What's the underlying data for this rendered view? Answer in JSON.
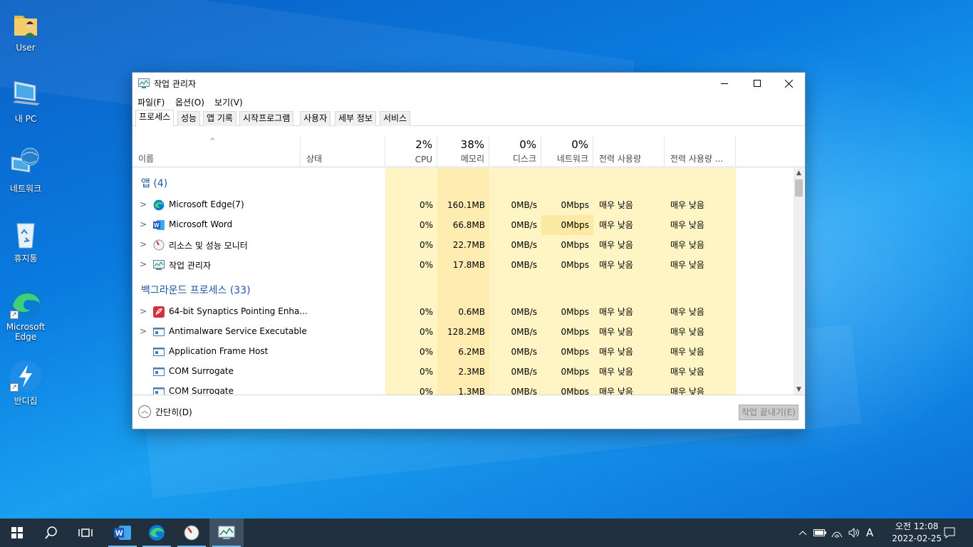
{
  "desktop": {
    "icons": [
      {
        "label": "User"
      },
      {
        "label": "내 PC"
      },
      {
        "label": "네트워크"
      },
      {
        "label": "휴지통"
      },
      {
        "label": "Microsoft Edge"
      },
      {
        "label": "반디집"
      }
    ]
  },
  "window": {
    "title": "작업 관리자",
    "menu": [
      "파일(F)",
      "옵션(O)",
      "보기(V)"
    ],
    "tabs": [
      "프로세스",
      "성능",
      "앱 기록",
      "시작프로그램",
      "사용자",
      "세부 정보",
      "서비스"
    ],
    "active_tab": "프로세스",
    "columns": {
      "name": "이름",
      "status": "상태",
      "cpu": {
        "pct": "2%",
        "label": "CPU"
      },
      "memory": {
        "pct": "38%",
        "label": "메모리"
      },
      "disk": {
        "pct": "0%",
        "label": "디스크"
      },
      "network": {
        "pct": "0%",
        "label": "네트워크"
      },
      "power": "전력 사용량",
      "power_trend": "전력 사용량 ..."
    },
    "groups": [
      {
        "label": "앱 (4)"
      },
      {
        "label": "백그라운드 프로세스 (33)"
      }
    ],
    "apps": [
      {
        "icon": "edge-icon",
        "name": "Microsoft Edge(7)",
        "cpu": "0%",
        "mem": "160.1MB",
        "disk": "0MB/s",
        "net": "0Mbps",
        "power": "매우 낮음",
        "trend": "매우 낮음",
        "expandable": ">"
      },
      {
        "icon": "word-icon",
        "name": "Microsoft Word",
        "cpu": "0%",
        "mem": "66.8MB",
        "disk": "0MB/s",
        "net": "0Mbps",
        "power": "매우 낮음",
        "trend": "매우 낮음",
        "expandable": ">"
      },
      {
        "icon": "resource-monitor-icon",
        "name": "리소스 및 성능 모니터",
        "cpu": "0%",
        "mem": "22.7MB",
        "disk": "0MB/s",
        "net": "0Mbps",
        "power": "매우 낮음",
        "trend": "매우 낮음",
        "expandable": ">"
      },
      {
        "icon": "task-manager-icon",
        "name": "작업 관리자",
        "cpu": "0%",
        "mem": "17.8MB",
        "disk": "0MB/s",
        "net": "0Mbps",
        "power": "매우 낮음",
        "trend": "매우 낮음",
        "expandable": ">"
      }
    ],
    "background": [
      {
        "icon": "synaptics-icon",
        "name": "64-bit Synaptics Pointing Enha...",
        "cpu": "0%",
        "mem": "0.6MB",
        "disk": "0MB/s",
        "net": "0Mbps",
        "power": "매우 낮음",
        "trend": "매우 낮음",
        "expandable": ">"
      },
      {
        "icon": "service-icon",
        "name": "Antimalware Service Executable",
        "cpu": "0%",
        "mem": "128.2MB",
        "disk": "0MB/s",
        "net": "0Mbps",
        "power": "매우 낮음",
        "trend": "매우 낮음",
        "expandable": ">"
      },
      {
        "icon": "service-icon",
        "name": "Application Frame Host",
        "cpu": "0%",
        "mem": "6.2MB",
        "disk": "0MB/s",
        "net": "0Mbps",
        "power": "매우 낮음",
        "trend": "매우 낮음",
        "expandable": ""
      },
      {
        "icon": "service-icon",
        "name": "COM Surrogate",
        "cpu": "0%",
        "mem": "2.3MB",
        "disk": "0MB/s",
        "net": "0Mbps",
        "power": "매우 낮음",
        "trend": "매우 낮음",
        "expandable": ""
      },
      {
        "icon": "service-icon",
        "name": "COM Surrogate",
        "cpu": "0%",
        "mem": "1.3MB",
        "disk": "0MB/s",
        "net": "0Mbps",
        "power": "매우 낮음",
        "trend": "매우 낮음",
        "expandable": ""
      }
    ],
    "footer": {
      "collapse_label": "간단히(D)",
      "end_task_label": "작업 끝내기(E)"
    }
  },
  "taskbar": {
    "pinned": [
      "start-icon",
      "search-icon",
      "task-view-icon",
      "word-icon",
      "edge-icon",
      "resource-monitor-icon",
      "task-manager-icon"
    ],
    "ime": "A",
    "time": "오전 12:08",
    "date": "2022-02-25"
  },
  "colors": {
    "accent": "#1e57a6",
    "heat_light": "#fff4c4",
    "heat_mem": "#ffecb0",
    "taskbar": "#20303f"
  }
}
